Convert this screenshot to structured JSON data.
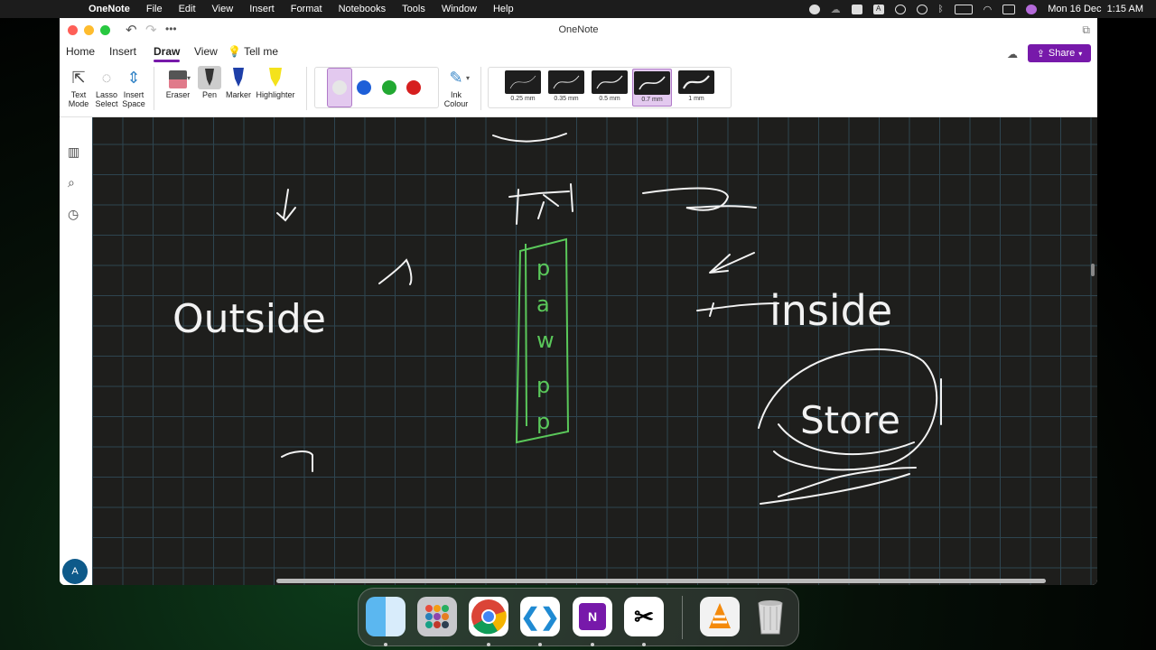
{
  "menubar": {
    "app_name": "OneNote",
    "items": [
      "File",
      "Edit",
      "View",
      "Insert",
      "Format",
      "Notebooks",
      "Tools",
      "Window",
      "Help"
    ],
    "clock": "Mon 16 Dec  1:15 AM",
    "status_letter": "A"
  },
  "window": {
    "title": "OneNote"
  },
  "ribbon_tabs": [
    "Home",
    "Insert",
    "Draw",
    "View"
  ],
  "tell_me": "Tell me",
  "share_label": "Share",
  "tools": {
    "text_mode": [
      "Text",
      "Mode"
    ],
    "lasso_select": [
      "Lasso",
      "Select"
    ],
    "insert_space": [
      "Insert",
      "Space"
    ],
    "eraser": "Eraser",
    "pen": "Pen",
    "marker": "Marker",
    "highlighter": "Highlighter",
    "ink_colour": [
      "Ink",
      "Colour"
    ]
  },
  "ink_colors": [
    "#e6e6e6",
    "#1e5fd8",
    "#22a832",
    "#d61f1f"
  ],
  "selected_color_index": 0,
  "thickness_options": [
    "0.25 mm",
    "0.35 mm",
    "0.5 mm",
    "0.7 mm",
    "1 mm"
  ],
  "selected_thickness": "0.7 mm",
  "drawing": {
    "words": [
      "Outside",
      "inside",
      "Store"
    ],
    "box_letters": [
      "p",
      "a",
      "w",
      "p",
      "p"
    ]
  },
  "avatar_initial": "A",
  "dock": [
    "Finder",
    "Launchpad",
    "Chrome",
    "VS Code",
    "OneNote",
    "CapCut",
    "VLC",
    "Trash"
  ],
  "accent_color": "#7719aa"
}
